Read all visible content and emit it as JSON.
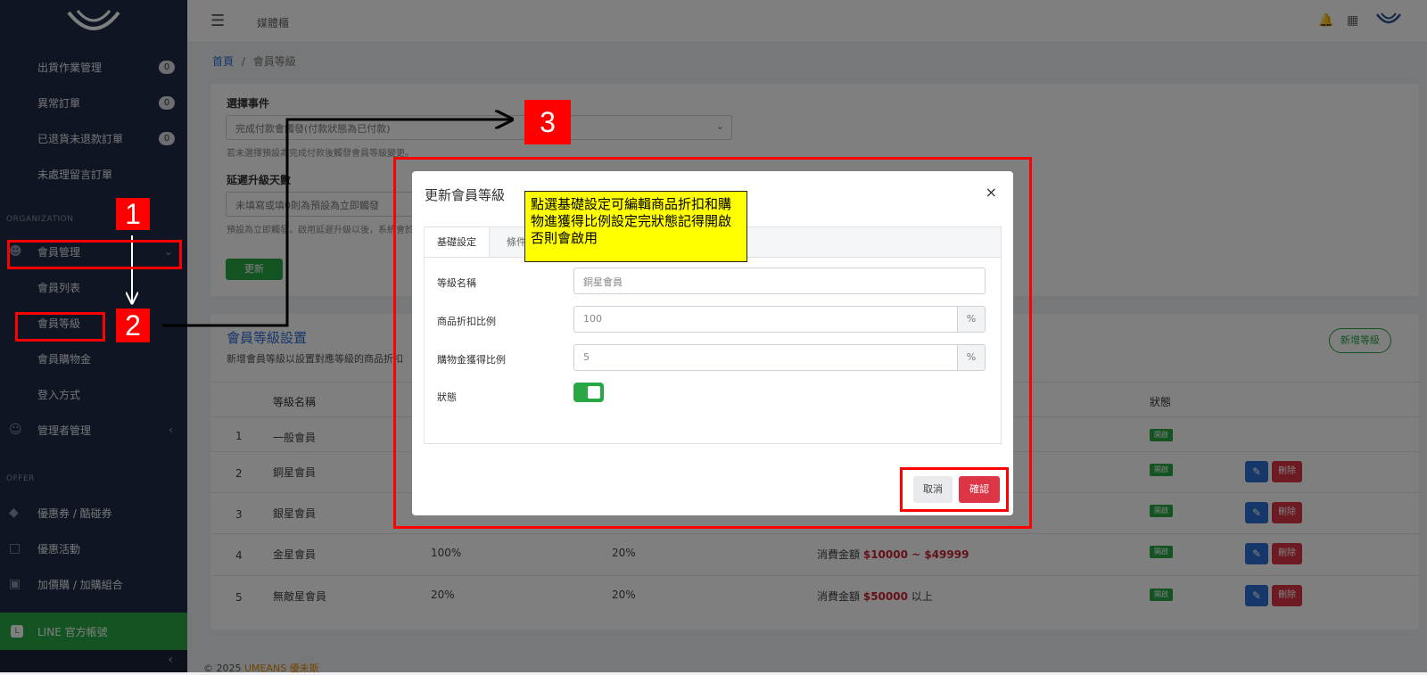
{
  "app": {
    "title": "媒體櫃"
  },
  "sidebar": {
    "items": [
      {
        "label": "出貨作業管理",
        "badge": "0"
      },
      {
        "label": "異常訂單",
        "badge": "0"
      },
      {
        "label": "已退貨未退款訂單",
        "badge": "0"
      },
      {
        "label": "未處理留言訂單"
      }
    ],
    "section_org": "ORGANIZATION",
    "member_mgmt": "會員管理",
    "member_sub": [
      "會員列表",
      "會員等級",
      "會員購物金",
      "登入方式"
    ],
    "admin_mgmt": "管理者管理",
    "section_offer": "OFFER",
    "offer_items": [
      "優惠券 / 酷碰券",
      "優惠活動",
      "加價購 / 加購組合"
    ],
    "line": "LINE 官方帳號"
  },
  "breadcrumb": {
    "home": "首頁",
    "sep": "/",
    "current": "會員等級"
  },
  "event_form": {
    "select_label": "選擇事件",
    "select_value": "完成付款會觸發(付款狀態為已付款)",
    "select_hint": "若未選擇預設為完成付款後觸發會員等級變更。",
    "delay_label": "延遲升級天數",
    "delay_placeholder": "未填寫或填0則為預設為立即觸發",
    "delay_hint": "預設為立即觸發，啟用延遲升級以後，系統會於",
    "update_button": "更新"
  },
  "levels": {
    "title": "會員等級設置",
    "desc": "新增會員等級以設置對應等級的商品折扣",
    "add_button": "新增等級",
    "columns": {
      "name": "等級名稱",
      "status": "狀態"
    },
    "rows": [
      {
        "no": "1",
        "name": "一般會員",
        "discount": "",
        "ratio": "",
        "cond_prefix": "",
        "cond_amount": "",
        "cond_suffix": "",
        "status": "開啟",
        "actions": false
      },
      {
        "no": "2",
        "name": "銅星會員",
        "discount": "",
        "ratio": "",
        "cond_prefix": "",
        "cond_amount": "",
        "cond_suffix": "",
        "status": "開啟",
        "actions": true
      },
      {
        "no": "3",
        "name": "銀星會員",
        "discount": "",
        "ratio": "",
        "cond_prefix": "",
        "cond_amount": "",
        "cond_suffix": "",
        "status": "開啟",
        "actions": true
      },
      {
        "no": "4",
        "name": "金星會員",
        "discount": "100%",
        "ratio": "20%",
        "cond_prefix": "消費金額",
        "cond_amount": "$10000 ~ $49999",
        "cond_suffix": "",
        "status": "開啟",
        "actions": true
      },
      {
        "no": "5",
        "name": "無敵星會員",
        "discount": "20%",
        "ratio": "20%",
        "cond_prefix": "消費金額",
        "cond_amount": "$50000",
        "cond_suffix": "以上",
        "status": "開啟",
        "actions": true
      }
    ],
    "delete_label": "刪除"
  },
  "footer": {
    "copyright": "© 2025",
    "brand": "UMEANS 優未斯"
  },
  "modal": {
    "title": "更新會員等級",
    "close": "×",
    "tabs": [
      "基礎設定",
      "條件"
    ],
    "fields": {
      "name_label": "等級名稱",
      "name_value": "銅星會員",
      "discount_label": "商品折扣比例",
      "discount_value": "100",
      "ratio_label": "購物金獲得比例",
      "ratio_value": "5",
      "unit": "%",
      "status_label": "狀態",
      "status_on": true
    },
    "cancel": "取消",
    "confirm": "確認"
  },
  "annotations": {
    "n1": "1",
    "n2": "2",
    "n3": "3",
    "note": "點選基礎設定可編輯商品折扣和購物進獲得比例設定完狀態記得開啟否則會啟用"
  },
  "colors": {
    "sidebar": "#1f2a44",
    "accent": "#28a745",
    "danger": "#dc3545",
    "link": "#2d6fd5",
    "annotation": "#ff0000",
    "note_bg": "#ffff00"
  }
}
